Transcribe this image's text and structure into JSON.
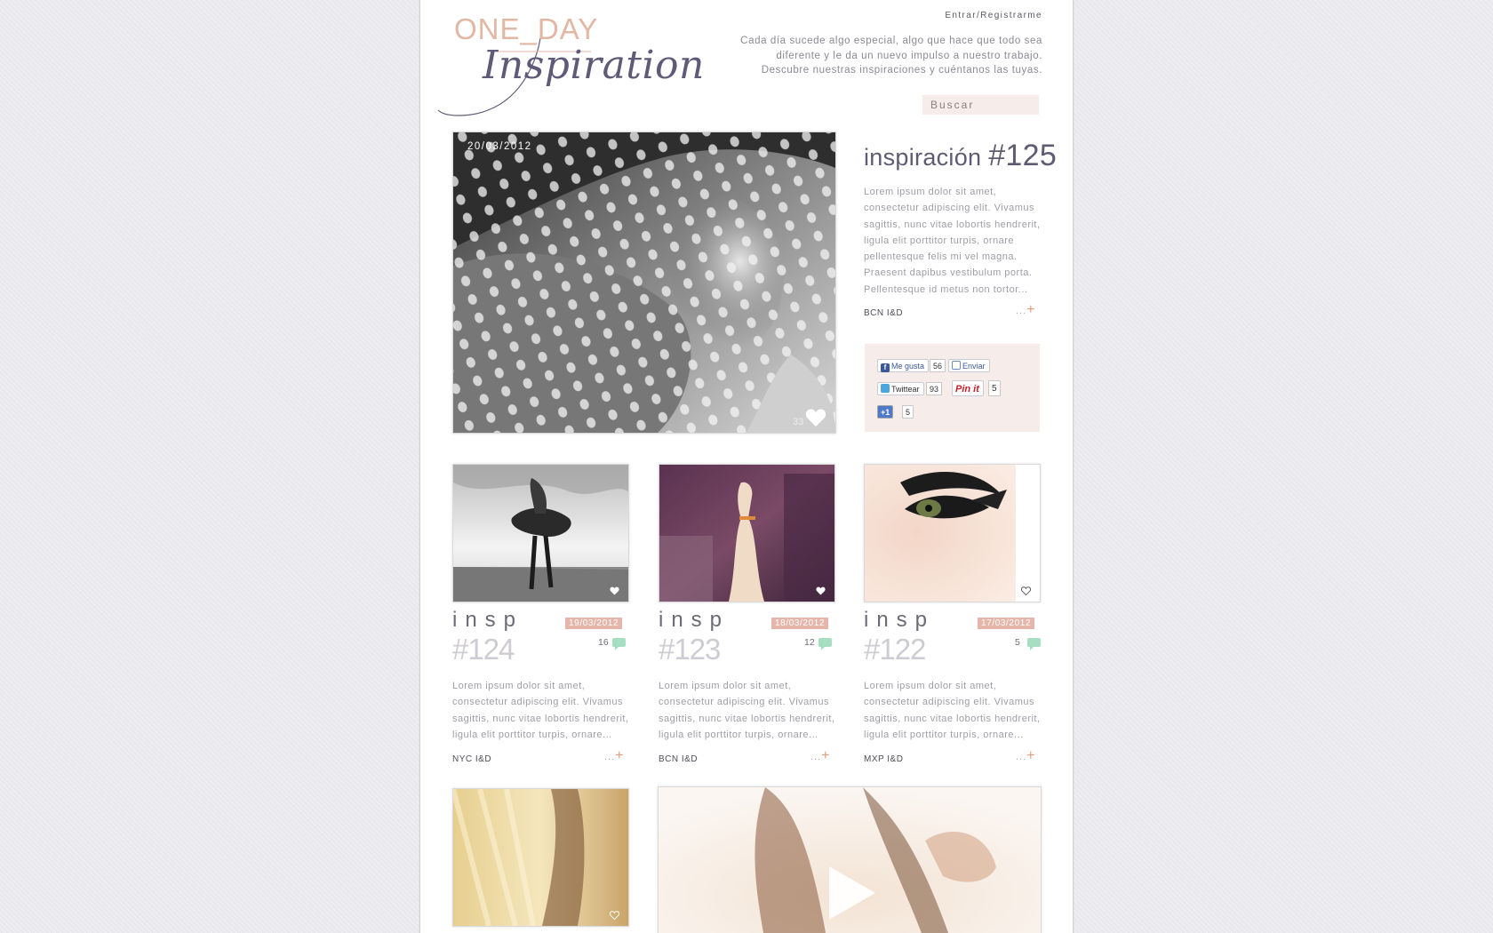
{
  "header": {
    "logo_line1": "ONE_DAY",
    "logo_line2": "Inspiration",
    "login": "Entrar/Registrarme",
    "tagline": "Cada día sucede algo especial, algo que hace que todo sea diferente y le da un nuevo impulso a nuestro trabajo. Descubre nuestras inspiraciones y cuéntanos las tuyas.",
    "search_placeholder": "Buscar"
  },
  "featured": {
    "date": "20/03/2012",
    "likes": "33",
    "title_word": "inspiración",
    "title_number": "#125",
    "text": "Lorem ipsum dolor sit amet, consectetur adipiscing elit. Vivamus sagittis, nunc vitae lobortis hendrerit, ligula elit porttitor turpis, ornare pellentesque felis mi vel magna. Praesent dapibus vestibulum porta. Pellentesque id metus non tortor...",
    "location": "BCN I&D",
    "more": "...",
    "more_plus": "+"
  },
  "share": {
    "fb_like": "Me gusta",
    "fb_like_count": "56",
    "fb_send": "Enviar",
    "twitter": "Twittear",
    "twitter_count": "93",
    "pinit": "Pin it",
    "pinit_count": "5",
    "gplus": "+1",
    "gplus_count": "5"
  },
  "cards": [
    {
      "insp": "insp",
      "num": "#124",
      "date": "19/03/2012",
      "comments": "16",
      "text": "Lorem ipsum dolor sit amet, consectetur adipiscing elit. Vivamus sagittis, nunc vitae lobortis hendrerit, ligula elit porttitor turpis, ornare...",
      "location": "NYC I&D",
      "more": "...",
      "more_plus": "+"
    },
    {
      "insp": "insp",
      "num": "#123",
      "date": "18/03/2012",
      "comments": "12",
      "text": "Lorem ipsum dolor sit amet, consectetur adipiscing elit. Vivamus sagittis, nunc vitae lobortis hendrerit, ligula elit porttitor turpis, ornare...",
      "location": "BCN I&D",
      "more": "...",
      "more_plus": "+"
    },
    {
      "insp": "insp",
      "num": "#122",
      "date": "17/03/2012",
      "comments": "5",
      "text": "Lorem ipsum dolor sit amet, consectetur adipiscing elit. Vivamus sagittis, nunc vitae lobortis hendrerit, ligula elit porttitor turpis, ornare...",
      "location": "MXP I&D",
      "more": "...",
      "more_plus": "+"
    }
  ],
  "colors": {
    "accent_peach": "#e7b6aa",
    "plus_orange": "#e69b79",
    "comment_green": "#a6dec1",
    "share_bg": "#f6ecea",
    "title_purple": "#5e5b72"
  },
  "icons": [
    "heart-icon",
    "comment-bubble-icon",
    "facebook-icon",
    "twitter-icon",
    "pinterest-icon",
    "google-plus-icon",
    "play-icon"
  ]
}
